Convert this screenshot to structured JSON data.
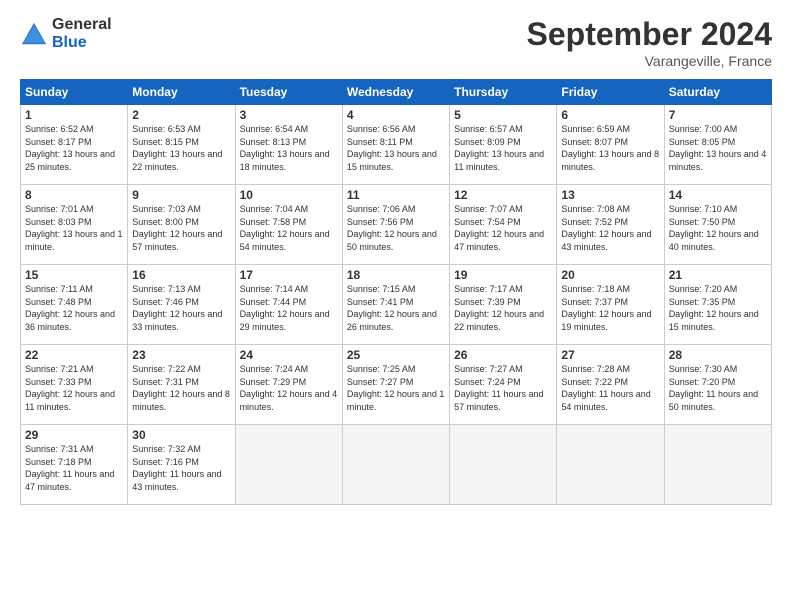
{
  "header": {
    "logo_general": "General",
    "logo_blue": "Blue",
    "title": "September 2024",
    "location": "Varangeville, France"
  },
  "days_of_week": [
    "Sunday",
    "Monday",
    "Tuesday",
    "Wednesday",
    "Thursday",
    "Friday",
    "Saturday"
  ],
  "weeks": [
    [
      {
        "day": 1,
        "sunrise": "6:52 AM",
        "sunset": "8:17 PM",
        "daylight": "13 hours and 25 minutes."
      },
      {
        "day": 2,
        "sunrise": "6:53 AM",
        "sunset": "8:15 PM",
        "daylight": "13 hours and 22 minutes."
      },
      {
        "day": 3,
        "sunrise": "6:54 AM",
        "sunset": "8:13 PM",
        "daylight": "13 hours and 18 minutes."
      },
      {
        "day": 4,
        "sunrise": "6:56 AM",
        "sunset": "8:11 PM",
        "daylight": "13 hours and 15 minutes."
      },
      {
        "day": 5,
        "sunrise": "6:57 AM",
        "sunset": "8:09 PM",
        "daylight": "13 hours and 11 minutes."
      },
      {
        "day": 6,
        "sunrise": "6:59 AM",
        "sunset": "8:07 PM",
        "daylight": "13 hours and 8 minutes."
      },
      {
        "day": 7,
        "sunrise": "7:00 AM",
        "sunset": "8:05 PM",
        "daylight": "13 hours and 4 minutes."
      }
    ],
    [
      {
        "day": 8,
        "sunrise": "7:01 AM",
        "sunset": "8:03 PM",
        "daylight": "13 hours and 1 minute."
      },
      {
        "day": 9,
        "sunrise": "7:03 AM",
        "sunset": "8:00 PM",
        "daylight": "12 hours and 57 minutes."
      },
      {
        "day": 10,
        "sunrise": "7:04 AM",
        "sunset": "7:58 PM",
        "daylight": "12 hours and 54 minutes."
      },
      {
        "day": 11,
        "sunrise": "7:06 AM",
        "sunset": "7:56 PM",
        "daylight": "12 hours and 50 minutes."
      },
      {
        "day": 12,
        "sunrise": "7:07 AM",
        "sunset": "7:54 PM",
        "daylight": "12 hours and 47 minutes."
      },
      {
        "day": 13,
        "sunrise": "7:08 AM",
        "sunset": "7:52 PM",
        "daylight": "12 hours and 43 minutes."
      },
      {
        "day": 14,
        "sunrise": "7:10 AM",
        "sunset": "7:50 PM",
        "daylight": "12 hours and 40 minutes."
      }
    ],
    [
      {
        "day": 15,
        "sunrise": "7:11 AM",
        "sunset": "7:48 PM",
        "daylight": "12 hours and 36 minutes."
      },
      {
        "day": 16,
        "sunrise": "7:13 AM",
        "sunset": "7:46 PM",
        "daylight": "12 hours and 33 minutes."
      },
      {
        "day": 17,
        "sunrise": "7:14 AM",
        "sunset": "7:44 PM",
        "daylight": "12 hours and 29 minutes."
      },
      {
        "day": 18,
        "sunrise": "7:15 AM",
        "sunset": "7:41 PM",
        "daylight": "12 hours and 26 minutes."
      },
      {
        "day": 19,
        "sunrise": "7:17 AM",
        "sunset": "7:39 PM",
        "daylight": "12 hours and 22 minutes."
      },
      {
        "day": 20,
        "sunrise": "7:18 AM",
        "sunset": "7:37 PM",
        "daylight": "12 hours and 19 minutes."
      },
      {
        "day": 21,
        "sunrise": "7:20 AM",
        "sunset": "7:35 PM",
        "daylight": "12 hours and 15 minutes."
      }
    ],
    [
      {
        "day": 22,
        "sunrise": "7:21 AM",
        "sunset": "7:33 PM",
        "daylight": "12 hours and 11 minutes."
      },
      {
        "day": 23,
        "sunrise": "7:22 AM",
        "sunset": "7:31 PM",
        "daylight": "12 hours and 8 minutes."
      },
      {
        "day": 24,
        "sunrise": "7:24 AM",
        "sunset": "7:29 PM",
        "daylight": "12 hours and 4 minutes."
      },
      {
        "day": 25,
        "sunrise": "7:25 AM",
        "sunset": "7:27 PM",
        "daylight": "12 hours and 1 minute."
      },
      {
        "day": 26,
        "sunrise": "7:27 AM",
        "sunset": "7:24 PM",
        "daylight": "11 hours and 57 minutes."
      },
      {
        "day": 27,
        "sunrise": "7:28 AM",
        "sunset": "7:22 PM",
        "daylight": "11 hours and 54 minutes."
      },
      {
        "day": 28,
        "sunrise": "7:30 AM",
        "sunset": "7:20 PM",
        "daylight": "11 hours and 50 minutes."
      }
    ],
    [
      {
        "day": 29,
        "sunrise": "7:31 AM",
        "sunset": "7:18 PM",
        "daylight": "11 hours and 47 minutes."
      },
      {
        "day": 30,
        "sunrise": "7:32 AM",
        "sunset": "7:16 PM",
        "daylight": "11 hours and 43 minutes."
      },
      null,
      null,
      null,
      null,
      null
    ]
  ]
}
